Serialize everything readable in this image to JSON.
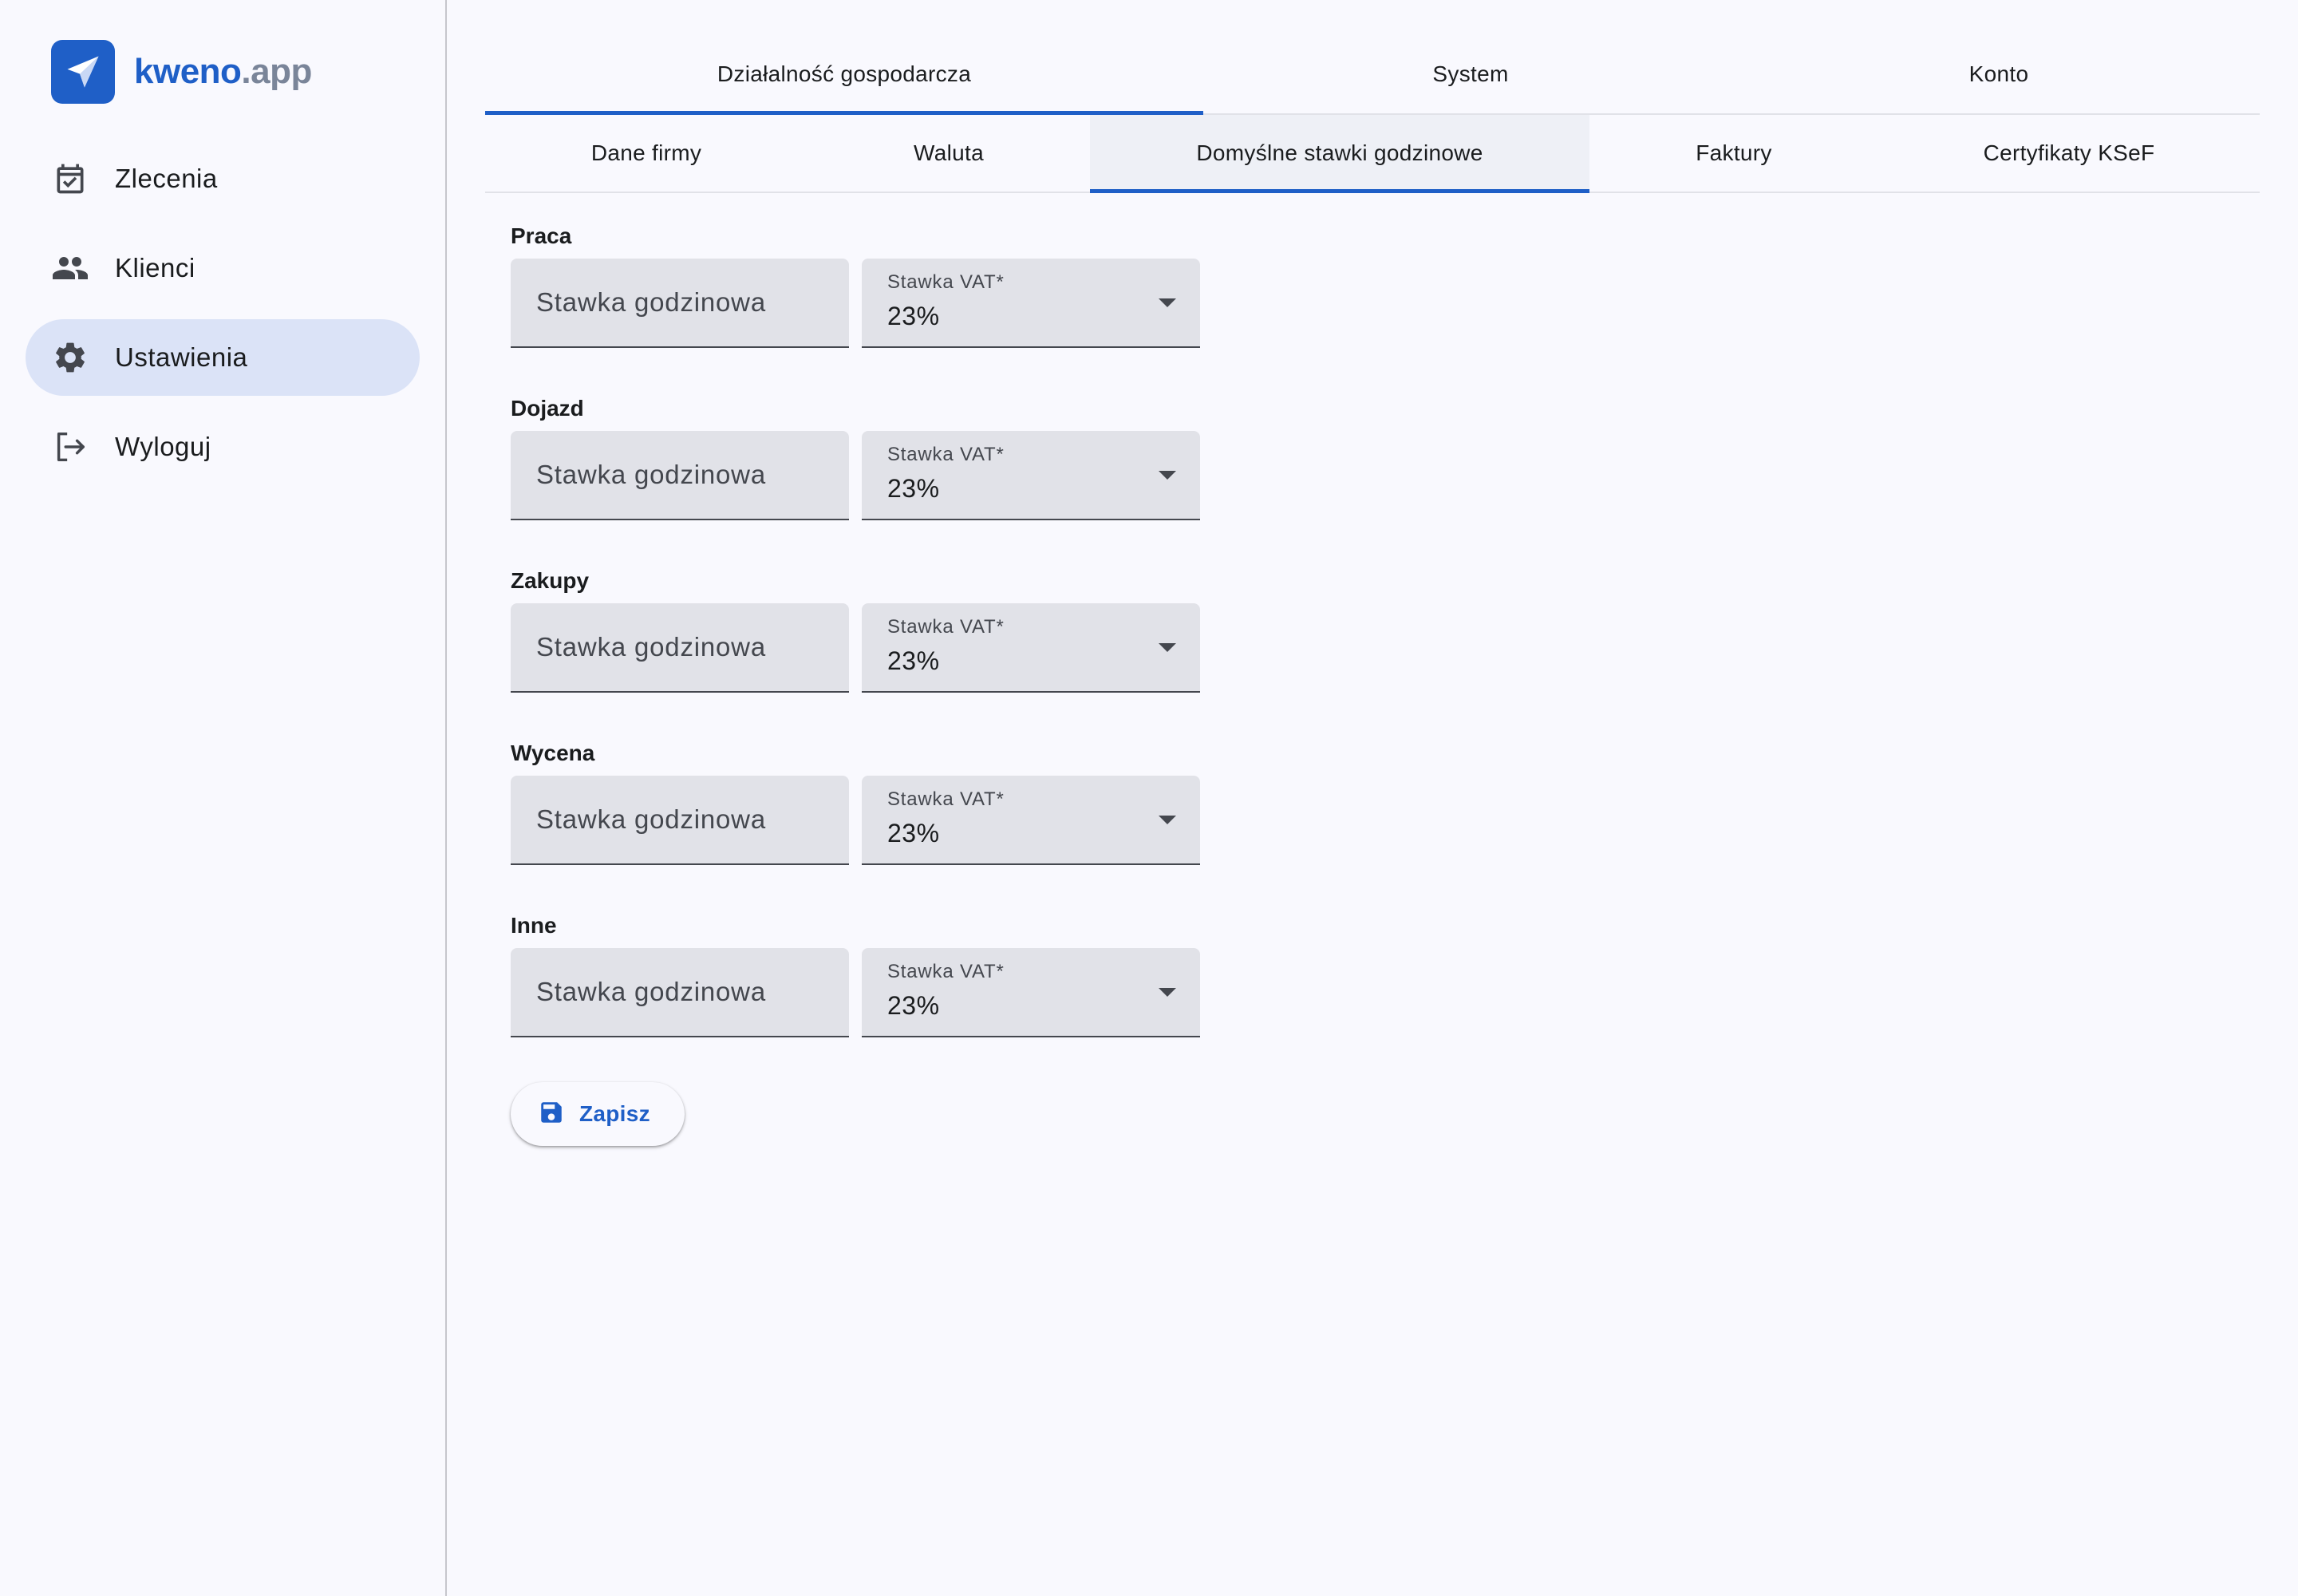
{
  "brand": {
    "name": "kweno",
    "tld": ".app"
  },
  "sidebar": {
    "items": [
      {
        "label": "Zlecenia",
        "icon": "calendar-check-icon",
        "active": false
      },
      {
        "label": "Klienci",
        "icon": "people-icon",
        "active": false
      },
      {
        "label": "Ustawienia",
        "icon": "gear-icon",
        "active": true
      },
      {
        "label": "Wyloguj",
        "icon": "logout-icon",
        "active": false
      }
    ]
  },
  "tabs": {
    "top": [
      {
        "label": "Działalność gospodarcza",
        "active": true
      },
      {
        "label": "System",
        "active": false
      },
      {
        "label": "Konto",
        "active": false
      }
    ],
    "sub": [
      {
        "label": "Dane firmy",
        "active": false
      },
      {
        "label": "Waluta",
        "active": false
      },
      {
        "label": "Domyślne stawki godzinowe",
        "active": true
      },
      {
        "label": "Faktury",
        "active": false
      },
      {
        "label": "Certyfikaty KSeF",
        "active": false
      }
    ]
  },
  "rates": [
    {
      "title": "Praca",
      "rate_placeholder": "Stawka godzinowa",
      "vat_label": "Stawka VAT*",
      "vat_value": "23%"
    },
    {
      "title": "Dojazd",
      "rate_placeholder": "Stawka godzinowa",
      "vat_label": "Stawka VAT*",
      "vat_value": "23%"
    },
    {
      "title": "Zakupy",
      "rate_placeholder": "Stawka godzinowa",
      "vat_label": "Stawka VAT*",
      "vat_value": "23%"
    },
    {
      "title": "Wycena",
      "rate_placeholder": "Stawka godzinowa",
      "vat_label": "Stawka VAT*",
      "vat_value": "23%"
    },
    {
      "title": "Inne",
      "rate_placeholder": "Stawka godzinowa",
      "vat_label": "Stawka VAT*",
      "vat_value": "23%"
    }
  ],
  "actions": {
    "save_label": "Zapisz",
    "save_icon": "floppy-disk-icon"
  },
  "colors": {
    "accent": "#1f5fc7",
    "active_nav_bg": "#dbe3f7",
    "field_bg": "#e1e2e8"
  }
}
